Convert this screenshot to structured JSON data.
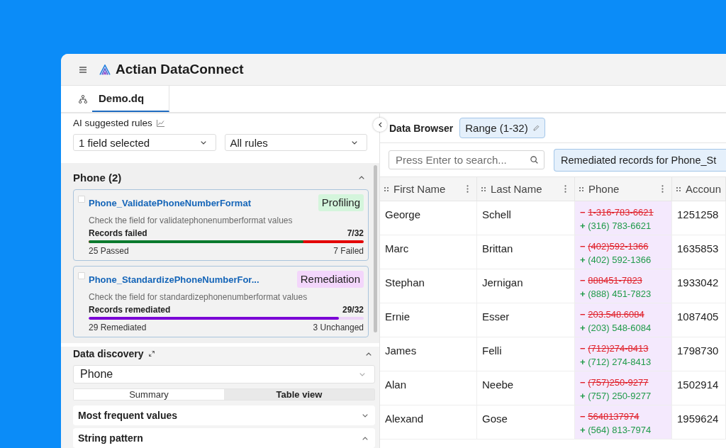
{
  "window": {
    "title": "Actian DataConnect"
  },
  "tabs": [
    {
      "label": "Demo.dq",
      "selected": true
    }
  ],
  "rules_panel": {
    "title": "AI suggested rules",
    "field_filter": {
      "value": "1 field selected"
    },
    "rule_filter": {
      "value": "All rules"
    },
    "groups": [
      {
        "name": "Phone (2)",
        "expanded": true,
        "rules": [
          {
            "kind": "profiling",
            "checked": false,
            "name": "Phone_ValidatePhoneNumberFormat",
            "badge": "Profiling",
            "description": "Check the field for validatephonenumberformat values",
            "metric_label": "Records failed",
            "metric_value": "7/32",
            "level": 0.78,
            "left_caption": "25 Passed",
            "right_caption": "7 Failed"
          },
          {
            "kind": "remediation",
            "checked": false,
            "name": "Phone_StandardizePhoneNumberFor...",
            "badge": "Remediation",
            "description": "Check the field for standardizephonenumberformat values",
            "metric_label": "Records remediated",
            "metric_value": "29/32",
            "level": 0.91,
            "left_caption": "29 Remediated",
            "right_caption": "3 Unchanged"
          }
        ]
      }
    ]
  },
  "data_discovery": {
    "title": "Data discovery",
    "expanded": true,
    "field": {
      "value": "Phone"
    },
    "views": [
      {
        "label": "Summary",
        "selected": false
      },
      {
        "label": "Table view",
        "selected": true
      }
    ],
    "sections": [
      {
        "title": "Most frequent values",
        "expanded": false
      },
      {
        "title": "String pattern",
        "expanded": true
      }
    ]
  },
  "data_browser": {
    "title": "Data Browser",
    "range": "Range (1-32)",
    "search": {
      "placeholder": "Press Enter to search..."
    },
    "filter": "Remediated records for Phone_St",
    "table": {
      "columns": [
        {
          "label": "First Name",
          "menu": true,
          "highlighted": false
        },
        {
          "label": "Last Name",
          "menu": true,
          "highlighted": false
        },
        {
          "label": "Phone",
          "menu": true,
          "highlighted": true
        },
        {
          "label": "Accoun",
          "menu": false,
          "highlighted": false
        }
      ],
      "rows": [
        {
          "cells": [
            {
              "kind": "text",
              "text": "George"
            },
            {
              "kind": "text",
              "text": "Schell"
            },
            {
              "kind": "diff",
              "removed_sign": "−",
              "removed": "1-316-783-6621",
              "added_sign": "+",
              "added": "(316) 783-6621"
            },
            {
              "kind": "text",
              "text": "1251258"
            }
          ]
        },
        {
          "cells": [
            {
              "kind": "text",
              "text": "Marc"
            },
            {
              "kind": "text",
              "text": "Brittan"
            },
            {
              "kind": "diff",
              "removed_sign": "−",
              "removed": "(402)592-1366",
              "added_sign": "+",
              "added": "(402) 592-1366"
            },
            {
              "kind": "text",
              "text": "1635853"
            }
          ]
        },
        {
          "cells": [
            {
              "kind": "text",
              "text": "Stephan"
            },
            {
              "kind": "text",
              "text": "Jernigan"
            },
            {
              "kind": "diff",
              "removed_sign": "−",
              "removed": "888451-7823",
              "added_sign": "+",
              "added": "(888) 451-7823"
            },
            {
              "kind": "text",
              "text": "1933042"
            }
          ]
        },
        {
          "cells": [
            {
              "kind": "text",
              "text": "Ernie"
            },
            {
              "kind": "text",
              "text": "Esser"
            },
            {
              "kind": "diff",
              "removed_sign": "−",
              "removed": "203.548.6084",
              "added_sign": "+",
              "added": "(203) 548-6084"
            },
            {
              "kind": "text",
              "text": "1087405"
            }
          ]
        },
        {
          "cells": [
            {
              "kind": "text",
              "text": "James"
            },
            {
              "kind": "text",
              "text": "Felli"
            },
            {
              "kind": "diff",
              "removed_sign": "−",
              "removed": "(712)274-8413",
              "added_sign": "+",
              "added": "(712) 274-8413"
            },
            {
              "kind": "text",
              "text": "1798730"
            }
          ]
        },
        {
          "cells": [
            {
              "kind": "text",
              "text": "Alan"
            },
            {
              "kind": "text",
              "text": "Neebe"
            },
            {
              "kind": "diff",
              "removed_sign": "−",
              "removed": "(757)250-9277",
              "added_sign": "+",
              "added": "(757) 250-9277"
            },
            {
              "kind": "text",
              "text": "1502914"
            }
          ]
        },
        {
          "cells": [
            {
              "kind": "text",
              "text": "Alexand"
            },
            {
              "kind": "text",
              "text": "Gose"
            },
            {
              "kind": "diff",
              "removed_sign": "−",
              "removed": "5648137974",
              "added_sign": "+",
              "added": "(564) 813-7974"
            },
            {
              "kind": "text",
              "text": "1959624"
            }
          ]
        }
      ]
    }
  }
}
